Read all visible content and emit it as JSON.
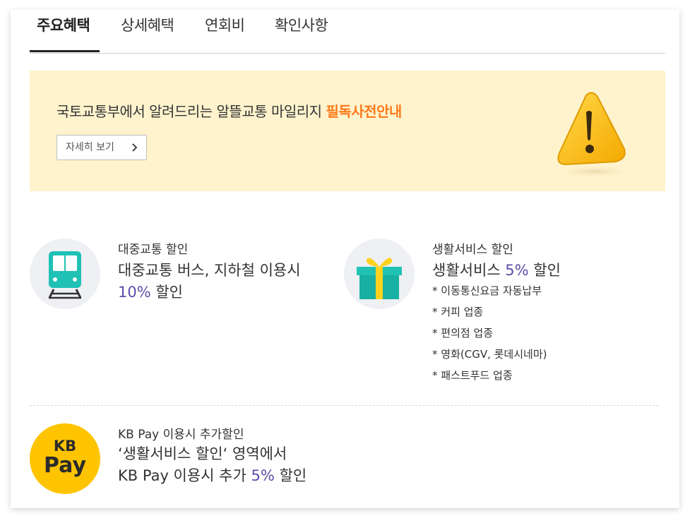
{
  "tabs": [
    {
      "label": "주요혜택",
      "active": true
    },
    {
      "label": "상세혜택",
      "active": false
    },
    {
      "label": "연회비",
      "active": false
    },
    {
      "label": "확인사항",
      "active": false
    }
  ],
  "banner": {
    "title": "국토교통부에서 알려드리는 알뜰교통 마일리지 ",
    "title_highlight": "필독사전안내",
    "button_label": "자세히 보기",
    "button_icon": "chevron-right-icon",
    "image_icon": "warning-icon",
    "bg_color": "#fff3cd",
    "highlight_color": "#ff7a1a"
  },
  "benefits": {
    "transit": {
      "icon": "train-icon",
      "title": "대중교통 할인",
      "desc_line1": "대중교통 버스, 지하철 이용시",
      "desc_pct": "10%",
      "desc_suffix": " 할인"
    },
    "living": {
      "icon": "gift-icon",
      "title": "생활서비스 할인",
      "desc_prefix": "생활서비스 ",
      "desc_pct": "5%",
      "desc_suffix": " 할인",
      "items": [
        "* 이동통신요금 자동납부",
        "* 커피 업종",
        "* 편의점 업종",
        "* 영화(CGV, 롯데시네마)",
        "* 패스트푸드 업종"
      ]
    },
    "kbpay": {
      "logo_line1": "KB",
      "logo_line2": "Pay",
      "title": "KB Pay 이용시 추가할인",
      "desc_line1": "‘생활서비스 할인‘ 영역에서",
      "desc_prefix": "KB Pay 이용시 추가 ",
      "desc_pct": "5%",
      "desc_suffix": " 할인"
    }
  },
  "colors": {
    "accent_purple": "#5b4ea8",
    "kb_yellow": "#ffc400"
  }
}
